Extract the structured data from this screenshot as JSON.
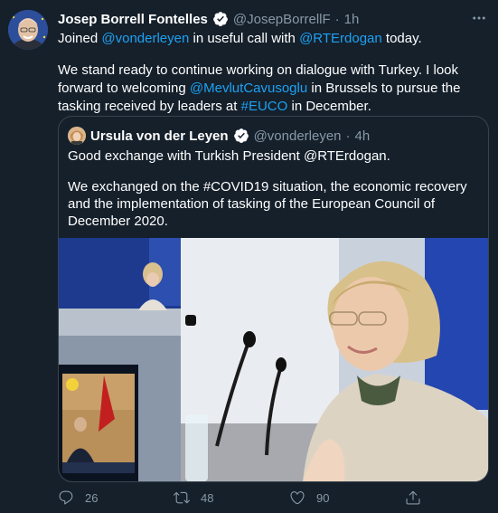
{
  "author": {
    "name": "Josep Borrell Fontelles",
    "handle": "@JosepBorrellF",
    "time": "1h"
  },
  "body": {
    "p1_prefix": "Joined",
    "p1_mention1": "@vonderleyen",
    "p1_mid": "in useful call with",
    "p1_mention2": "@RTErdogan",
    "p1_suffix": "today.",
    "p2_prefix": "We stand ready to continue working on dialogue with Turkey. I look forward to welcoming",
    "p2_mention": "@MevlutCavusoglu",
    "p2_mid": "in Brussels to pursue the tasking received by leaders at",
    "p2_hashtag": "#EUCO",
    "p2_suffix": "in December."
  },
  "quoted": {
    "name": "Ursula von der Leyen",
    "handle": "@vonderleyen",
    "time": "4h",
    "p1": "Good exchange with Turkish President @RTErdogan.",
    "p2": "We exchanged on the #COVID19 situation, the economic recovery and the implementation of tasking of the European Council of December 2020."
  },
  "actions": {
    "replies": "26",
    "retweets": "48",
    "likes": "90"
  },
  "icons": {
    "verified": "verified-badge-icon",
    "more": "more-options-icon",
    "reply": "reply-icon",
    "retweet": "retweet-icon",
    "like": "heart-icon",
    "share": "share-icon"
  },
  "colors": {
    "background": "#15202b",
    "link": "#1da1f2",
    "secondary_text": "#8899a6",
    "border": "#38444d"
  }
}
